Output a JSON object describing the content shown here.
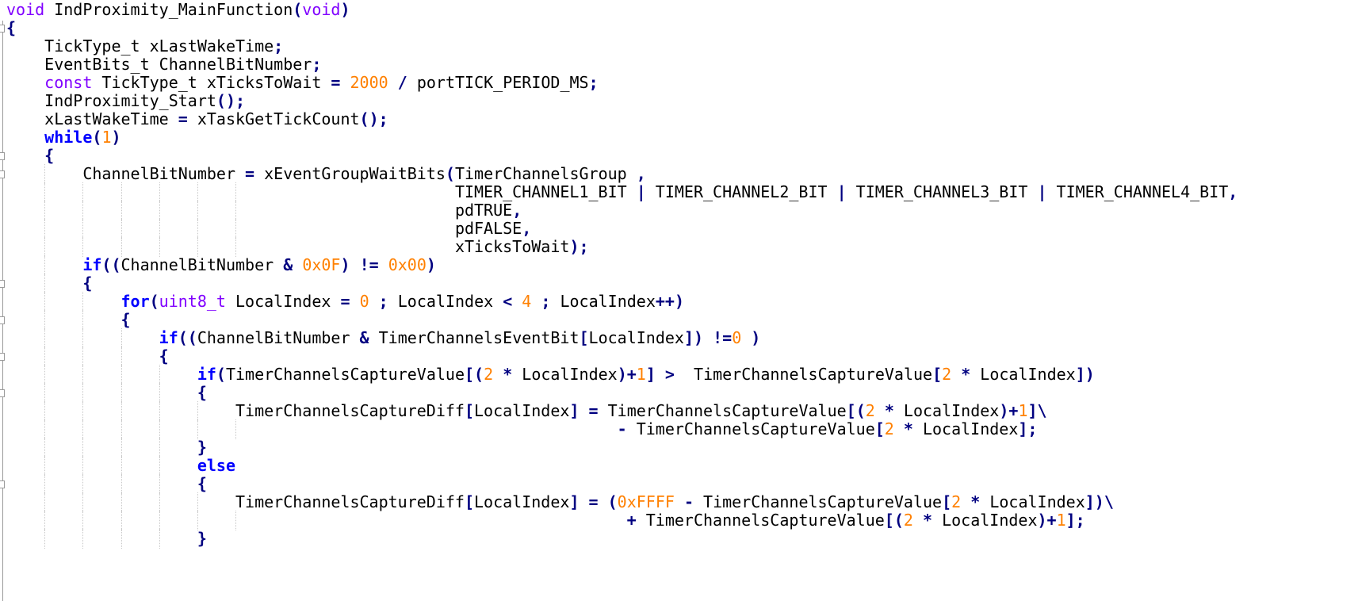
{
  "editor": {
    "lines": [
      {
        "indent": 0,
        "fold": false,
        "tokens": [
          [
            "ty",
            "void"
          ],
          [
            "tx",
            " IndProximity_MainFunction"
          ],
          [
            "op",
            "("
          ],
          [
            "ty",
            "void"
          ],
          [
            "op",
            ")"
          ]
        ]
      },
      {
        "indent": 0,
        "fold": true,
        "tokens": [
          [
            "op",
            "{"
          ]
        ]
      },
      {
        "indent": 4,
        "fold": false,
        "tokens": [
          [
            "tx",
            "TickType_t xLastWakeTime"
          ],
          [
            "op",
            ";"
          ]
        ]
      },
      {
        "indent": 4,
        "fold": false,
        "tokens": [
          [
            "tx",
            "EventBits_t ChannelBitNumber"
          ],
          [
            "op",
            ";"
          ]
        ]
      },
      {
        "indent": 4,
        "fold": false,
        "tokens": [
          [
            "ty",
            "const"
          ],
          [
            "tx",
            " TickType_t xTicksToWait "
          ],
          [
            "op",
            "="
          ],
          [
            "tx",
            " "
          ],
          [
            "num",
            "2000"
          ],
          [
            "tx",
            " "
          ],
          [
            "op",
            "/"
          ],
          [
            "tx",
            " portTICK_PERIOD_MS"
          ],
          [
            "op",
            ";"
          ]
        ]
      },
      {
        "indent": 4,
        "fold": false,
        "tokens": [
          [
            "tx",
            "IndProximity_Start"
          ],
          [
            "op",
            "();"
          ]
        ]
      },
      {
        "indent": 4,
        "fold": false,
        "tokens": [
          [
            "tx",
            "xLastWakeTime "
          ],
          [
            "op",
            "="
          ],
          [
            "tx",
            " xTaskGetTickCount"
          ],
          [
            "op",
            "();"
          ]
        ]
      },
      {
        "indent": 4,
        "fold": false,
        "tokens": [
          [
            "kw",
            "while"
          ],
          [
            "op",
            "("
          ],
          [
            "num",
            "1"
          ],
          [
            "op",
            ")"
          ]
        ]
      },
      {
        "indent": 4,
        "fold": true,
        "tokens": [
          [
            "op",
            "{"
          ]
        ]
      },
      {
        "indent": 8,
        "fold": true,
        "tokens": [
          [
            "tx",
            "ChannelBitNumber "
          ],
          [
            "op",
            "="
          ],
          [
            "tx",
            " xEventGroupWaitBits"
          ],
          [
            "op",
            "("
          ],
          [
            "tx",
            "TimerChannelsGroup "
          ],
          [
            "op",
            ","
          ]
        ]
      },
      {
        "indent": 47,
        "fold": false,
        "tokens": [
          [
            "tx",
            "TIMER_CHANNEL1_BIT "
          ],
          [
            "op",
            "|"
          ],
          [
            "tx",
            " TIMER_CHANNEL2_BIT "
          ],
          [
            "op",
            "|"
          ],
          [
            "tx",
            " TIMER_CHANNEL3_BIT "
          ],
          [
            "op",
            "|"
          ],
          [
            "tx",
            " TIMER_CHANNEL4_BIT"
          ],
          [
            "op",
            ","
          ]
        ]
      },
      {
        "indent": 47,
        "fold": false,
        "tokens": [
          [
            "tx",
            "pdTRUE"
          ],
          [
            "op",
            ","
          ]
        ]
      },
      {
        "indent": 47,
        "fold": false,
        "tokens": [
          [
            "tx",
            "pdFALSE"
          ],
          [
            "op",
            ","
          ]
        ]
      },
      {
        "indent": 47,
        "fold": false,
        "tokens": [
          [
            "tx",
            "xTicksToWait"
          ],
          [
            "op",
            ");"
          ]
        ]
      },
      {
        "indent": 8,
        "fold": false,
        "tokens": [
          [
            "kw",
            "if"
          ],
          [
            "op",
            "(("
          ],
          [
            "tx",
            "ChannelBitNumber "
          ],
          [
            "op",
            "&"
          ],
          [
            "tx",
            " "
          ],
          [
            "num",
            "0x0F"
          ],
          [
            "op",
            ")"
          ],
          [
            "tx",
            " "
          ],
          [
            "op",
            "!="
          ],
          [
            "tx",
            " "
          ],
          [
            "num",
            "0x00"
          ],
          [
            "op",
            ")"
          ]
        ]
      },
      {
        "indent": 8,
        "fold": true,
        "tokens": [
          [
            "op",
            "{"
          ]
        ]
      },
      {
        "indent": 12,
        "fold": false,
        "tokens": [
          [
            "kw",
            "for"
          ],
          [
            "op",
            "("
          ],
          [
            "ty",
            "uint8_t"
          ],
          [
            "tx",
            " LocalIndex "
          ],
          [
            "op",
            "="
          ],
          [
            "tx",
            " "
          ],
          [
            "num",
            "0"
          ],
          [
            "tx",
            " "
          ],
          [
            "op",
            ";"
          ],
          [
            "tx",
            " LocalIndex "
          ],
          [
            "op",
            "<"
          ],
          [
            "tx",
            " "
          ],
          [
            "num",
            "4"
          ],
          [
            "tx",
            " "
          ],
          [
            "op",
            ";"
          ],
          [
            "tx",
            " LocalIndex"
          ],
          [
            "op",
            "++)"
          ]
        ]
      },
      {
        "indent": 12,
        "fold": true,
        "tokens": [
          [
            "op",
            "{"
          ]
        ]
      },
      {
        "indent": 16,
        "fold": false,
        "tokens": [
          [
            "kw",
            "if"
          ],
          [
            "op",
            "(("
          ],
          [
            "tx",
            "ChannelBitNumber "
          ],
          [
            "op",
            "&"
          ],
          [
            "tx",
            " TimerChannelsEventBit"
          ],
          [
            "op",
            "["
          ],
          [
            "tx",
            "LocalIndex"
          ],
          [
            "op",
            "])"
          ],
          [
            "tx",
            " "
          ],
          [
            "op",
            "!="
          ],
          [
            "num",
            "0"
          ],
          [
            "tx",
            " "
          ],
          [
            "op",
            ")"
          ]
        ]
      },
      {
        "indent": 16,
        "fold": true,
        "tokens": [
          [
            "op",
            "{"
          ]
        ]
      },
      {
        "indent": 20,
        "fold": false,
        "tokens": [
          [
            "kw",
            "if"
          ],
          [
            "op",
            "("
          ],
          [
            "tx",
            "TimerChannelsCaptureValue"
          ],
          [
            "op",
            "[("
          ],
          [
            "num",
            "2"
          ],
          [
            "tx",
            " "
          ],
          [
            "op",
            "*"
          ],
          [
            "tx",
            " LocalIndex"
          ],
          [
            "op",
            ")+"
          ],
          [
            "num",
            "1"
          ],
          [
            "op",
            "]"
          ],
          [
            "tx",
            " "
          ],
          [
            "op",
            ">"
          ],
          [
            "tx",
            "  TimerChannelsCaptureValue"
          ],
          [
            "op",
            "["
          ],
          [
            "num",
            "2"
          ],
          [
            "tx",
            " "
          ],
          [
            "op",
            "*"
          ],
          [
            "tx",
            " LocalIndex"
          ],
          [
            "op",
            "])"
          ]
        ]
      },
      {
        "indent": 20,
        "fold": true,
        "tokens": [
          [
            "op",
            "{"
          ]
        ]
      },
      {
        "indent": 24,
        "fold": false,
        "tokens": [
          [
            "tx",
            "TimerChannelsCaptureDiff"
          ],
          [
            "op",
            "["
          ],
          [
            "tx",
            "LocalIndex"
          ],
          [
            "op",
            "]"
          ],
          [
            "tx",
            " "
          ],
          [
            "op",
            "="
          ],
          [
            "tx",
            " TimerChannelsCaptureValue"
          ],
          [
            "op",
            "[("
          ],
          [
            "num",
            "2"
          ],
          [
            "tx",
            " "
          ],
          [
            "op",
            "*"
          ],
          [
            "tx",
            " LocalIndex"
          ],
          [
            "op",
            ")+"
          ],
          [
            "num",
            "1"
          ],
          [
            "op",
            "]\\"
          ]
        ]
      },
      {
        "indent": 64,
        "fold": false,
        "tokens": [
          [
            "op",
            "-"
          ],
          [
            "tx",
            " TimerChannelsCaptureValue"
          ],
          [
            "op",
            "["
          ],
          [
            "num",
            "2"
          ],
          [
            "tx",
            " "
          ],
          [
            "op",
            "*"
          ],
          [
            "tx",
            " LocalIndex"
          ],
          [
            "op",
            "];"
          ]
        ]
      },
      {
        "indent": 20,
        "fold": false,
        "tokens": [
          [
            "op",
            "}"
          ]
        ]
      },
      {
        "indent": 20,
        "fold": false,
        "tokens": [
          [
            "kw",
            "else"
          ]
        ]
      },
      {
        "indent": 20,
        "fold": true,
        "tokens": [
          [
            "op",
            "{"
          ]
        ]
      },
      {
        "indent": 24,
        "fold": false,
        "tokens": [
          [
            "tx",
            "TimerChannelsCaptureDiff"
          ],
          [
            "op",
            "["
          ],
          [
            "tx",
            "LocalIndex"
          ],
          [
            "op",
            "]"
          ],
          [
            "tx",
            " "
          ],
          [
            "op",
            "="
          ],
          [
            "tx",
            " "
          ],
          [
            "op",
            "("
          ],
          [
            "num",
            "0xFFFF"
          ],
          [
            "tx",
            " "
          ],
          [
            "op",
            "-"
          ],
          [
            "tx",
            " TimerChannelsCaptureValue"
          ],
          [
            "op",
            "["
          ],
          [
            "num",
            "2"
          ],
          [
            "tx",
            " "
          ],
          [
            "op",
            "*"
          ],
          [
            "tx",
            " LocalIndex"
          ],
          [
            "op",
            "])\\"
          ]
        ]
      },
      {
        "indent": 65,
        "fold": false,
        "tokens": [
          [
            "op",
            "+"
          ],
          [
            "tx",
            " TimerChannelsCaptureValue"
          ],
          [
            "op",
            "[("
          ],
          [
            "num",
            "2"
          ],
          [
            "tx",
            " "
          ],
          [
            "op",
            "*"
          ],
          [
            "tx",
            " LocalIndex"
          ],
          [
            "op",
            ")+"
          ],
          [
            "num",
            "1"
          ],
          [
            "op",
            "];"
          ]
        ]
      },
      {
        "indent": 20,
        "fold": false,
        "tokens": [
          [
            "op",
            "}"
          ]
        ]
      }
    ]
  }
}
